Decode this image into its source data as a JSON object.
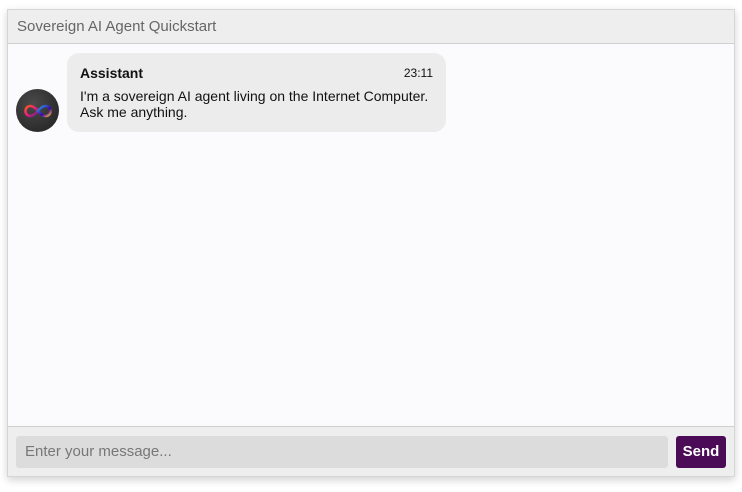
{
  "header": {
    "title": "Sovereign AI Agent Quickstart"
  },
  "messages": [
    {
      "sender": "Assistant",
      "time": "23:11",
      "text": "I'm a sovereign AI agent living on the Internet Computer. Ask me anything.",
      "avatar_icon": "infinity-logo-icon"
    }
  ],
  "composer": {
    "placeholder": "Enter your message...",
    "value": "",
    "send_label": "Send"
  },
  "colors": {
    "send_button": "#4b0b57",
    "bubble": "#ececec",
    "header": "#eeeeee"
  }
}
